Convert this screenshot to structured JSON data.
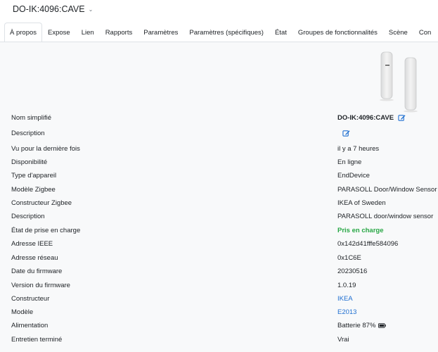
{
  "header": {
    "device_title": "DO-IK:4096:CAVE"
  },
  "tabs": [
    {
      "label": "À propos"
    },
    {
      "label": "Expose"
    },
    {
      "label": "Lien"
    },
    {
      "label": "Rapports"
    },
    {
      "label": "Paramètres"
    },
    {
      "label": "Paramètres (spécifiques)"
    },
    {
      "label": "État"
    },
    {
      "label": "Groupes de fonctionnalités"
    },
    {
      "label": "Scène"
    },
    {
      "label": "Con"
    }
  ],
  "info": {
    "friendly_name": {
      "label": "Nom simplifié",
      "value": "DO-IK:4096:CAVE"
    },
    "description": {
      "label": "Description"
    },
    "last_seen": {
      "label": "Vu pour la dernière fois",
      "value": "il y a 7 heures"
    },
    "availability": {
      "label": "Disponibilité",
      "value": "En ligne"
    },
    "device_type": {
      "label": "Type d'appareil",
      "value": "EndDevice"
    },
    "zigbee_model": {
      "label": "Modèle Zigbee",
      "value": "PARASOLL Door/Window Sensor"
    },
    "zigbee_manufacturer": {
      "label": "Constructeur Zigbee",
      "value": "IKEA of Sweden"
    },
    "description2": {
      "label": "Description",
      "value": "PARASOLL door/window sensor"
    },
    "support_status": {
      "label": "État de prise en charge",
      "value": "Pris en charge"
    },
    "ieee_address": {
      "label": "Adresse IEEE",
      "value": "0x142d41fffe584096"
    },
    "network_address": {
      "label": "Adresse réseau",
      "value": "0x1C6E"
    },
    "firmware_date": {
      "label": "Date du firmware",
      "value": "20230516"
    },
    "firmware_version": {
      "label": "Version du firmware",
      "value": "1.0.19"
    },
    "manufacturer": {
      "label": "Constructeur",
      "value": "IKEA"
    },
    "model": {
      "label": "Modèle",
      "value": "E2013"
    },
    "power": {
      "label": "Alimentation",
      "value": "Batterie 87%"
    },
    "interview_completed": {
      "label": "Entretien terminé",
      "value": "Vrai"
    }
  },
  "colors": {
    "accent": "#1f6fd1",
    "success": "#28a745",
    "panel_bg": "#f8f9fa"
  },
  "icons": {
    "edit": "edit-icon",
    "battery": "battery-icon",
    "chevron": "chevron-down-icon"
  }
}
